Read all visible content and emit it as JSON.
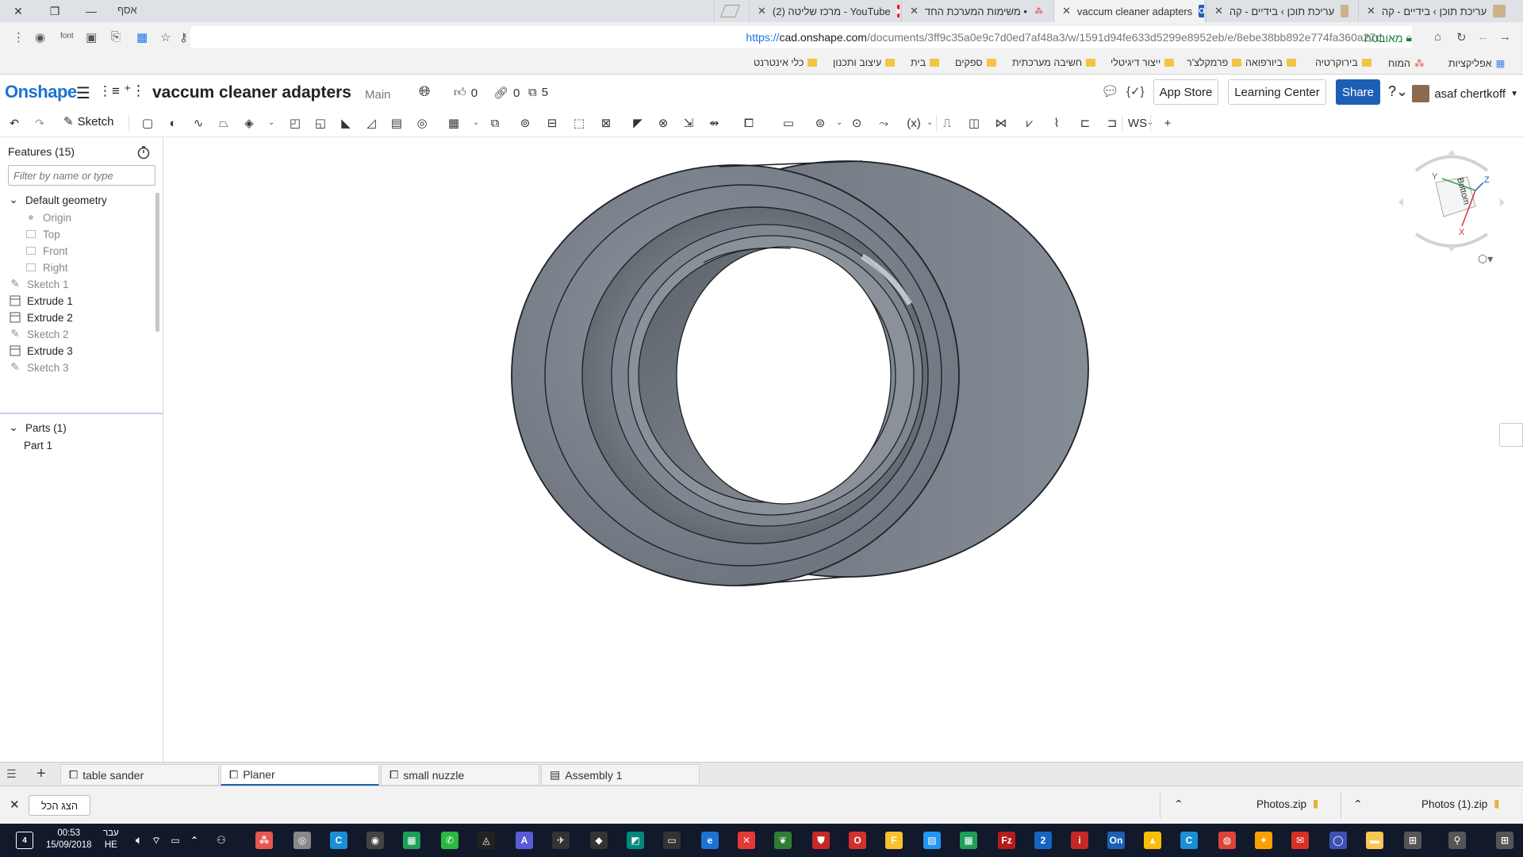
{
  "browser": {
    "profile_label": "אסף",
    "tabs": [
      {
        "title": "עריכת תוכן › בידיים - קה"
      },
      {
        "title": "עריכת תוכן › בידיים - קה"
      },
      {
        "title": "vaccum cleaner adapters",
        "favicon": "On"
      },
      {
        "title": "משימות המערכת החד •"
      },
      {
        "title": "(2) מרכז שליטה - YouTube"
      }
    ],
    "url_prefix": "https://",
    "url_host": "cad.onshape.com",
    "url_path": "/documents/3ff9c35a0e9c7d0ed7af48a3/w/1591d94fe633d5299e8952eb/e/8ebe38bb892e774fa360a27d",
    "secure_label": "מאובטח",
    "bookmarks": [
      "אפליקציות",
      "המוח",
      "בירוקרטיה",
      "ביורפואה",
      "פרמקלצ'ר",
      "ייצור דיגיטלי",
      "חשיבה מערכתית",
      "ספקים",
      "בית",
      "עיצוב ותכנון",
      "כלי אינטרנט"
    ]
  },
  "header": {
    "logo": "Onshape",
    "doc_title": "vaccum cleaner adapters",
    "workspace": "Main",
    "likes": "0",
    "links": "0",
    "versions": "5",
    "app_store": "App Store",
    "learning_center": "Learning Center",
    "share": "Share",
    "user": "asaf chertkoff"
  },
  "toolbar": {
    "sketch_label": "Sketch"
  },
  "features": {
    "title": "Features (15)",
    "filter_placeholder": "Filter by name or type",
    "default_geometry": "Default geometry",
    "items": [
      {
        "label": "Origin",
        "icon": "origin-icon"
      },
      {
        "label": "Top",
        "icon": "plane-icon"
      },
      {
        "label": "Front",
        "icon": "plane-icon"
      },
      {
        "label": "Right",
        "icon": "plane-icon"
      },
      {
        "label": "Sketch 1",
        "icon": "sketch-icon"
      },
      {
        "label": "Extrude 1",
        "icon": "extrude-icon"
      },
      {
        "label": "Extrude 2",
        "icon": "extrude-icon"
      },
      {
        "label": "Sketch 2",
        "icon": "sketch-icon"
      },
      {
        "label": "Extrude 3",
        "icon": "extrude-icon"
      },
      {
        "label": "Sketch 3",
        "icon": "sketch-icon"
      }
    ],
    "parts_title": "Parts (1)",
    "parts": [
      "Part 1"
    ]
  },
  "viewcube": {
    "face": "Bottom",
    "axis_x": "X",
    "axis_y": "Y",
    "axis_z": "Z"
  },
  "doc_tabs": [
    {
      "label": "table sander",
      "active": false
    },
    {
      "label": "Planer",
      "active": true
    },
    {
      "label": "small nuzzle",
      "active": false
    },
    {
      "label": "Assembly 1",
      "active": false
    }
  ],
  "downloads": {
    "show_all": "הצג הכל",
    "files": [
      "Photos.zip",
      "Photos (1).zip"
    ]
  },
  "taskbar": {
    "time": "00:53",
    "date": "15/09/2018",
    "lang_top": "עבר",
    "lang_bottom": "HE"
  }
}
